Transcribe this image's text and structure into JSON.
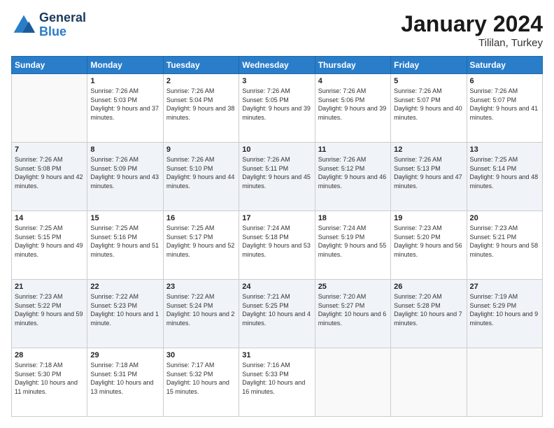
{
  "logo": {
    "line1": "General",
    "line2": "Blue"
  },
  "title": "January 2024",
  "location": "Tililan, Turkey",
  "weekdays": [
    "Sunday",
    "Monday",
    "Tuesday",
    "Wednesday",
    "Thursday",
    "Friday",
    "Saturday"
  ],
  "weeks": [
    [
      {
        "day": "",
        "sunrise": "",
        "sunset": "",
        "daylight": ""
      },
      {
        "day": "1",
        "sunrise": "Sunrise: 7:26 AM",
        "sunset": "Sunset: 5:03 PM",
        "daylight": "Daylight: 9 hours and 37 minutes."
      },
      {
        "day": "2",
        "sunrise": "Sunrise: 7:26 AM",
        "sunset": "Sunset: 5:04 PM",
        "daylight": "Daylight: 9 hours and 38 minutes."
      },
      {
        "day": "3",
        "sunrise": "Sunrise: 7:26 AM",
        "sunset": "Sunset: 5:05 PM",
        "daylight": "Daylight: 9 hours and 39 minutes."
      },
      {
        "day": "4",
        "sunrise": "Sunrise: 7:26 AM",
        "sunset": "Sunset: 5:06 PM",
        "daylight": "Daylight: 9 hours and 39 minutes."
      },
      {
        "day": "5",
        "sunrise": "Sunrise: 7:26 AM",
        "sunset": "Sunset: 5:07 PM",
        "daylight": "Daylight: 9 hours and 40 minutes."
      },
      {
        "day": "6",
        "sunrise": "Sunrise: 7:26 AM",
        "sunset": "Sunset: 5:07 PM",
        "daylight": "Daylight: 9 hours and 41 minutes."
      }
    ],
    [
      {
        "day": "7",
        "sunrise": "Sunrise: 7:26 AM",
        "sunset": "Sunset: 5:08 PM",
        "daylight": "Daylight: 9 hours and 42 minutes."
      },
      {
        "day": "8",
        "sunrise": "Sunrise: 7:26 AM",
        "sunset": "Sunset: 5:09 PM",
        "daylight": "Daylight: 9 hours and 43 minutes."
      },
      {
        "day": "9",
        "sunrise": "Sunrise: 7:26 AM",
        "sunset": "Sunset: 5:10 PM",
        "daylight": "Daylight: 9 hours and 44 minutes."
      },
      {
        "day": "10",
        "sunrise": "Sunrise: 7:26 AM",
        "sunset": "Sunset: 5:11 PM",
        "daylight": "Daylight: 9 hours and 45 minutes."
      },
      {
        "day": "11",
        "sunrise": "Sunrise: 7:26 AM",
        "sunset": "Sunset: 5:12 PM",
        "daylight": "Daylight: 9 hours and 46 minutes."
      },
      {
        "day": "12",
        "sunrise": "Sunrise: 7:26 AM",
        "sunset": "Sunset: 5:13 PM",
        "daylight": "Daylight: 9 hours and 47 minutes."
      },
      {
        "day": "13",
        "sunrise": "Sunrise: 7:25 AM",
        "sunset": "Sunset: 5:14 PM",
        "daylight": "Daylight: 9 hours and 48 minutes."
      }
    ],
    [
      {
        "day": "14",
        "sunrise": "Sunrise: 7:25 AM",
        "sunset": "Sunset: 5:15 PM",
        "daylight": "Daylight: 9 hours and 49 minutes."
      },
      {
        "day": "15",
        "sunrise": "Sunrise: 7:25 AM",
        "sunset": "Sunset: 5:16 PM",
        "daylight": "Daylight: 9 hours and 51 minutes."
      },
      {
        "day": "16",
        "sunrise": "Sunrise: 7:25 AM",
        "sunset": "Sunset: 5:17 PM",
        "daylight": "Daylight: 9 hours and 52 minutes."
      },
      {
        "day": "17",
        "sunrise": "Sunrise: 7:24 AM",
        "sunset": "Sunset: 5:18 PM",
        "daylight": "Daylight: 9 hours and 53 minutes."
      },
      {
        "day": "18",
        "sunrise": "Sunrise: 7:24 AM",
        "sunset": "Sunset: 5:19 PM",
        "daylight": "Daylight: 9 hours and 55 minutes."
      },
      {
        "day": "19",
        "sunrise": "Sunrise: 7:23 AM",
        "sunset": "Sunset: 5:20 PM",
        "daylight": "Daylight: 9 hours and 56 minutes."
      },
      {
        "day": "20",
        "sunrise": "Sunrise: 7:23 AM",
        "sunset": "Sunset: 5:21 PM",
        "daylight": "Daylight: 9 hours and 58 minutes."
      }
    ],
    [
      {
        "day": "21",
        "sunrise": "Sunrise: 7:23 AM",
        "sunset": "Sunset: 5:22 PM",
        "daylight": "Daylight: 9 hours and 59 minutes."
      },
      {
        "day": "22",
        "sunrise": "Sunrise: 7:22 AM",
        "sunset": "Sunset: 5:23 PM",
        "daylight": "Daylight: 10 hours and 1 minute."
      },
      {
        "day": "23",
        "sunrise": "Sunrise: 7:22 AM",
        "sunset": "Sunset: 5:24 PM",
        "daylight": "Daylight: 10 hours and 2 minutes."
      },
      {
        "day": "24",
        "sunrise": "Sunrise: 7:21 AM",
        "sunset": "Sunset: 5:25 PM",
        "daylight": "Daylight: 10 hours and 4 minutes."
      },
      {
        "day": "25",
        "sunrise": "Sunrise: 7:20 AM",
        "sunset": "Sunset: 5:27 PM",
        "daylight": "Daylight: 10 hours and 6 minutes."
      },
      {
        "day": "26",
        "sunrise": "Sunrise: 7:20 AM",
        "sunset": "Sunset: 5:28 PM",
        "daylight": "Daylight: 10 hours and 7 minutes."
      },
      {
        "day": "27",
        "sunrise": "Sunrise: 7:19 AM",
        "sunset": "Sunset: 5:29 PM",
        "daylight": "Daylight: 10 hours and 9 minutes."
      }
    ],
    [
      {
        "day": "28",
        "sunrise": "Sunrise: 7:18 AM",
        "sunset": "Sunset: 5:30 PM",
        "daylight": "Daylight: 10 hours and 11 minutes."
      },
      {
        "day": "29",
        "sunrise": "Sunrise: 7:18 AM",
        "sunset": "Sunset: 5:31 PM",
        "daylight": "Daylight: 10 hours and 13 minutes."
      },
      {
        "day": "30",
        "sunrise": "Sunrise: 7:17 AM",
        "sunset": "Sunset: 5:32 PM",
        "daylight": "Daylight: 10 hours and 15 minutes."
      },
      {
        "day": "31",
        "sunrise": "Sunrise: 7:16 AM",
        "sunset": "Sunset: 5:33 PM",
        "daylight": "Daylight: 10 hours and 16 minutes."
      },
      {
        "day": "",
        "sunrise": "",
        "sunset": "",
        "daylight": ""
      },
      {
        "day": "",
        "sunrise": "",
        "sunset": "",
        "daylight": ""
      },
      {
        "day": "",
        "sunrise": "",
        "sunset": "",
        "daylight": ""
      }
    ]
  ]
}
